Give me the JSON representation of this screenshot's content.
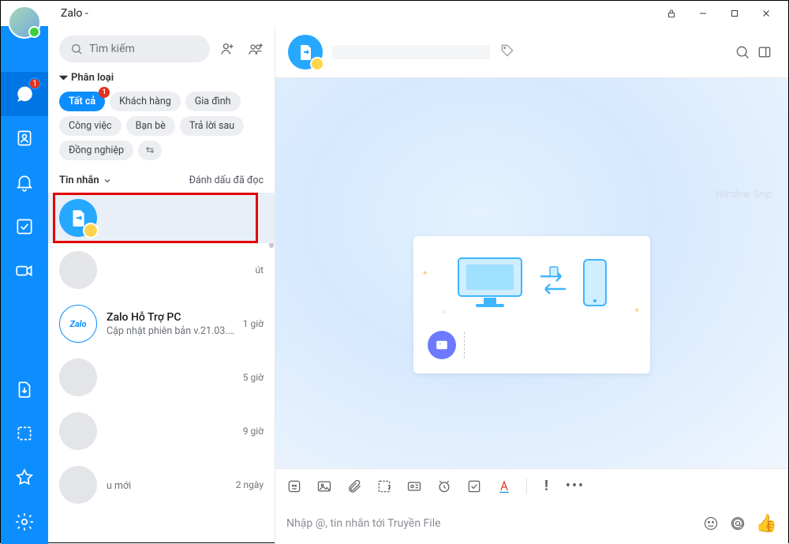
{
  "window": {
    "title": "Zalo -"
  },
  "rail": {
    "messages_badge": "1"
  },
  "search": {
    "placeholder": "Tìm kiếm"
  },
  "category": {
    "label": "Phân loại",
    "chips": {
      "all": "Tất cả",
      "all_badge": "1",
      "customer": "Khách hàng",
      "family": "Gia đình",
      "work": "Công việc",
      "friends": "Bạn bè",
      "reply_later": "Trả lời sau",
      "colleague": "Đồng nghiệp"
    }
  },
  "listhead": {
    "left": "Tin nhắn",
    "right": "Đánh dấu đã đọc"
  },
  "conversations": {
    "c1_time": "",
    "c2_time": "út",
    "c3_title": "Zalo Hỗ Trợ PC",
    "c3_sub": "Cập nhật phiên bản v.21.03.03...",
    "c3_time": "1 giờ",
    "c4_time": "5 giờ",
    "c5_time": "9 giờ",
    "c6_time": "2 ngày",
    "c6_sub": "u mới"
  },
  "chat": {
    "watermark": "Window Snip"
  },
  "compose": {
    "placeholder": "Nhập @, tin nhắn tới Truyền File"
  }
}
